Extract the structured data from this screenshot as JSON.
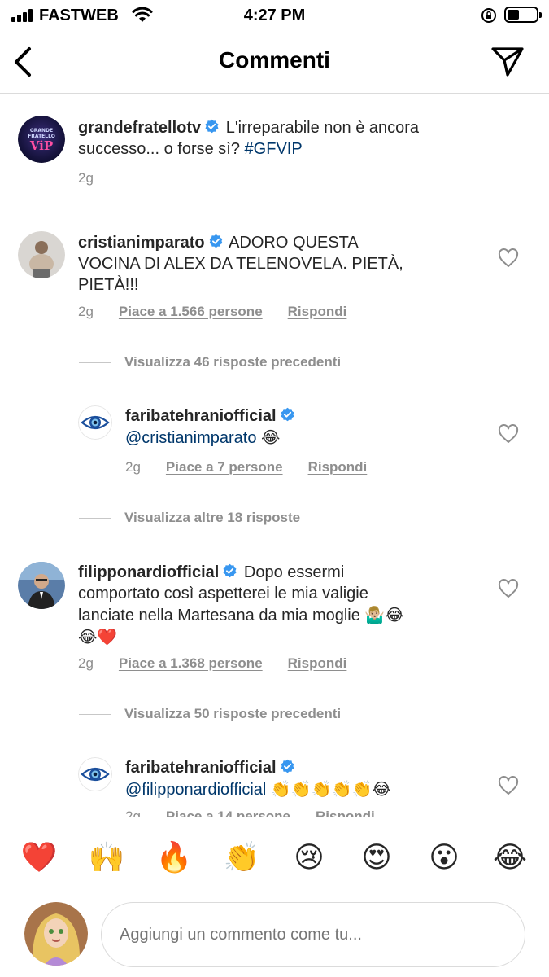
{
  "status": {
    "carrier": "FASTWEB",
    "time": "4:27 PM"
  },
  "header": {
    "title": "Commenti"
  },
  "caption": {
    "username": "grandefratellotv",
    "text_line1": "L'irreparabile non è ancora",
    "text_line2": "successo... o forse sì?",
    "hashtag": "#GFVIP",
    "age": "2g"
  },
  "comments": [
    {
      "username": "cristianimparato",
      "line1": "ADORO QUESTA",
      "line2": "VOCINA DI ALEX DA TELENOVELA. PIETÀ,",
      "line3": "PIETÀ!!!",
      "age": "2g",
      "likes": "Piace a 1.566 persone",
      "reply": "Rispondi",
      "view_more": "Visualizza 46 risposte precedenti"
    },
    {
      "username": "faribatehraniofficial",
      "mention": "@cristianimparato",
      "emoji": "😂",
      "age": "2g",
      "likes": "Piace a 7 persone",
      "reply": "Rispondi",
      "view_more": "Visualizza altre 18 risposte"
    },
    {
      "username": "filipponardiofficial",
      "line1": "Dopo essermi",
      "line2": "comportato così aspetterei le mia valigie",
      "line3": "lanciate nella Martesana da mia moglie",
      "line3_emoji": "🤷🏼‍♂️😂",
      "line4_emoji": "😂❤️",
      "age": "2g",
      "likes": "Piace a 1.368 persone",
      "reply": "Rispondi",
      "view_more": "Visualizza 50 risposte precedenti"
    },
    {
      "username": "faribatehraniofficial",
      "mention": "@filipponardiofficial",
      "emoji": "👏👏👏👏👏😂",
      "age": "2g",
      "likes": "Piace a 14 persone",
      "reply": "Rispondi"
    }
  ],
  "reactions": [
    "❤️",
    "🙌",
    "🔥",
    "👏",
    "😢",
    "😍",
    "😮",
    "😂"
  ],
  "composer": {
    "placeholder": "Aggiungi un commento come tu..."
  },
  "colors": {
    "accent": "#3897f0",
    "link": "#00376b",
    "muted": "#8e8e8e",
    "heart_red": "#ed4956"
  },
  "icons": [
    "signal-icon",
    "wifi-icon",
    "rotation-lock-icon",
    "battery-icon",
    "back-arrow-icon",
    "send-icon",
    "verified-badge-icon",
    "heart-outline-icon"
  ]
}
